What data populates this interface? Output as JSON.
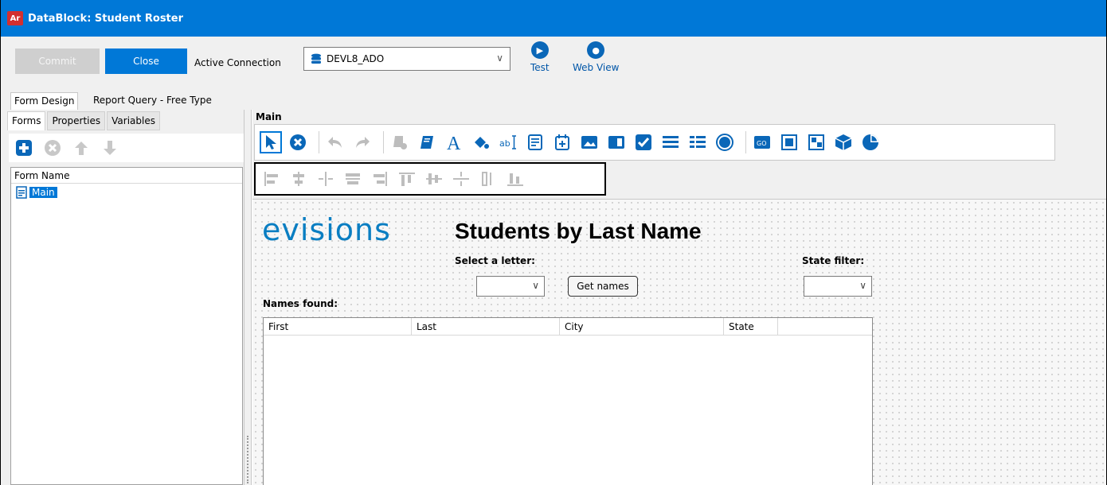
{
  "window": {
    "icon_text": "Ar",
    "title": "DataBlock: Student Roster"
  },
  "toolbar": {
    "commit_label": "Commit",
    "close_label": "Close",
    "active_connection_label": "Active Connection",
    "connection_value": "DEVL8_ADO",
    "test_label": "Test",
    "web_view_label": "Web View"
  },
  "tabs": [
    {
      "label": "Form Design",
      "active": true
    },
    {
      "label": "Report Query - Free Type",
      "active": false
    }
  ],
  "left_panel": {
    "subtabs": [
      {
        "label": "Forms",
        "active": true
      },
      {
        "label": "Properties",
        "active": false
      },
      {
        "label": "Variables",
        "active": false
      }
    ],
    "list_header": "Form Name",
    "forms": [
      {
        "name": "Main",
        "selected": true
      }
    ]
  },
  "designer": {
    "section_label": "Main",
    "toolbar_icons": [
      "pointer-icon",
      "delete-icon",
      "undo-icon",
      "redo-icon",
      "paste-icon",
      "book-icon",
      "text-icon",
      "paint-icon",
      "textbox-icon",
      "memo-icon",
      "date-icon",
      "image-icon",
      "panel-icon",
      "checkbox-icon",
      "list-icon",
      "grid-icon",
      "radio-icon",
      "button-icon",
      "frame-icon",
      "multi-icon",
      "cube-icon",
      "pie-icon"
    ],
    "align_icons": [
      "align-left-icon",
      "align-center-icon",
      "space-horizontal-icon",
      "align-middle-icon",
      "align-right-icon",
      "align-top-icon",
      "align-vmid-icon",
      "space-vertical-icon",
      "size-icon",
      "align-bottom-icon"
    ]
  },
  "canvas": {
    "logo_text": "evisions",
    "title": "Students by Last Name",
    "select_letter_label": "Select a letter:",
    "get_names_label": "Get names",
    "state_filter_label": "State filter:",
    "names_found_label": "Names found:",
    "columns": [
      "First",
      "Last",
      "City",
      "State"
    ]
  },
  "colors": {
    "accent": "#0078d7",
    "logo": "#0a7ec2",
    "icon": "#0a67b8"
  }
}
